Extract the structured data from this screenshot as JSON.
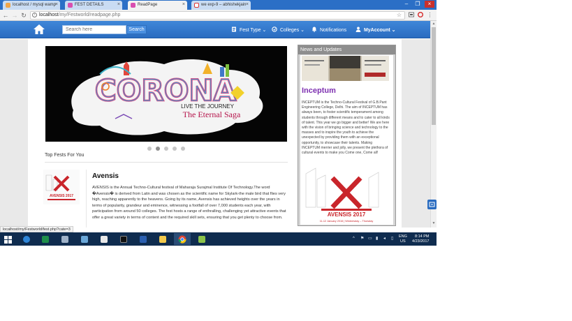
{
  "browser": {
    "tabs": [
      {
        "title": "localhost / mysql wamp"
      },
      {
        "title": "FEST DETAILS"
      },
      {
        "title": "ReadPage"
      },
      {
        "title": "we exp-9 – abhishekjain"
      }
    ],
    "url_host": "localhost",
    "url_path": "/my/Festworld/readpage.php"
  },
  "navbar": {
    "search_placeholder": "Search here",
    "search_button": "Search",
    "fest_type": "Fest Type",
    "colleges": "Colleges",
    "notifications": "Notifications",
    "account": "MyAccount"
  },
  "carousel": {
    "word": "CORONA",
    "tagline": "LIVE THE JOURNEY",
    "subtitle": "The Eternal Saga",
    "slide_count": 5,
    "active_slide": 2
  },
  "top_fests": {
    "heading": "Top Fests For You",
    "items": [
      {
        "title": "Avensis",
        "thumb_title": "AVENSIS 2017",
        "description": "AVENSIS is the Annual Techno-Cultural festival of Maharaja Surajmal Institute Of Technology.The word �Avensis� is derived from Latin and was chosen as the scientific name for Skylark-the male bird that flies very high, reaching apparently to the heavens. Going by its name, Avensis has achieved heights over the years in terms of popularity, grandeur and eminence, witnessing a footfall of over 7,000 students each year, with participation from around 50 colleges. The fest hosts a range of enthralling, challenging yet attractive events that offer a great variety in terms of content and the required skill sets, ensuring that you get plenty to choose from."
      }
    ]
  },
  "news": {
    "header": "News and Updates",
    "title": "Inceptum",
    "description": "INCEPTUM is the Techno-Cultural Festival of G.B.Pant Engineering College, Delhi. The aim of INCEPTUM has always been, to foster scientific temperament among students through different means and to cater to all kinds of talent. This year we go bigger and better! We are here with the vision of bringing science and technology to the masses and to inspire the youth to achieve the unexpected by providing them with an exceptional opportunity, to showcase their talents. Making INCEPTUM merrier and jolly, we present the plethora of cultural events to make you Come one, Come all!",
    "poster_title": "AVENSIS 2017",
    "poster_caption": "11-12 January 2016 | Wednesday – Thursday"
  },
  "status_url": "localhost/my/Festworld/fest.php?cate=3",
  "taskbar": {
    "lang_top": "ENG",
    "lang_bottom": "US",
    "time": "8:14 PM",
    "date": "4/23/2017"
  },
  "colors": {
    "navbar": "#2a6cc0",
    "news_title": "#7d2fb0",
    "taskbar": "#0f2c4f"
  }
}
